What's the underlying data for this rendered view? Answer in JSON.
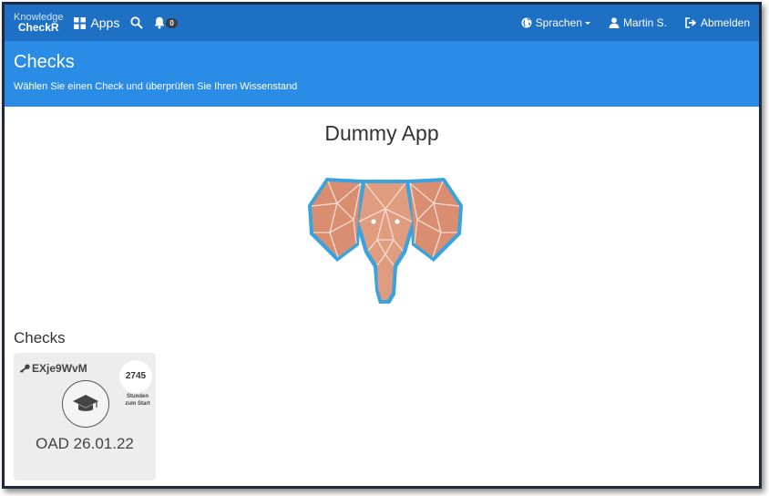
{
  "navbar": {
    "brand_line1": "Knowledge",
    "brand_line2": "CheckR",
    "apps_label": "Apps",
    "notification_count": "0",
    "language_label": "Sprachen",
    "user_label": "Martin S.",
    "logout_label": "Abmelden"
  },
  "header": {
    "title": "Checks",
    "subtitle": "Wählen Sie einen Check und überprüfen Sie Ihren Wissenstand"
  },
  "main": {
    "app_title": "Dummy App",
    "section_title": "Checks",
    "checks": [
      {
        "code": "EXje9WvM",
        "hours": "2745",
        "hours_label_1": "Stunden",
        "hours_label_2": "zum Start",
        "name": "OAD 26.01.22"
      }
    ]
  },
  "colors": {
    "navbar": "#1d70c4",
    "header": "#2b8ce5",
    "card": "#ededed",
    "logo_fill": "#d98e72",
    "logo_outline": "#3aa3de"
  },
  "icons": [
    "apps-grid-icon",
    "search-icon",
    "bell-icon",
    "globe-icon",
    "user-icon",
    "logout-icon",
    "key-icon",
    "graduation-cap-icon"
  ]
}
